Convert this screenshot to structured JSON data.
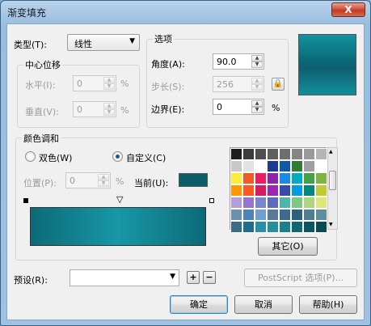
{
  "window": {
    "title": "渐变填充",
    "close_label": "X"
  },
  "type_row": {
    "label": "类型(T):",
    "selected": "线性"
  },
  "center_offset": {
    "title": "中心位移",
    "horizontal_label": "水平(I):",
    "horizontal_value": "0",
    "vertical_label": "垂直(V):",
    "vertical_value": "0",
    "unit": "%"
  },
  "options": {
    "title": "选项",
    "angle_label": "角度(A):",
    "angle_value": "90.0",
    "steps_label": "步长(S):",
    "steps_value": "256",
    "edge_label": "边界(E):",
    "edge_value": "0",
    "unit": "%"
  },
  "color_blend": {
    "title": "颜色调和",
    "two_color_label": "双色(W)",
    "custom_label": "自定义(C)",
    "selected_mode": "custom",
    "position_label": "位置(P):",
    "position_value": "0",
    "unit": "%",
    "current_label": "当前(U):",
    "current_color": "#0d5d6b",
    "gradient_start": "#0c6a78",
    "gradient_mid": "#1897a6",
    "other_button": "其它(O)"
  },
  "palette_colors": [
    "#1e1e1e",
    "#3b3b3b",
    "#4f4f4f",
    "#5e5e5e",
    "#6f6f6f",
    "#858585",
    "#9a9a9a",
    "#b5b5b5",
    "#c8c8c8",
    "#e2e2e2",
    "#ffffff",
    "#1f3a93",
    "#0f59a8",
    "#2e7d32",
    "#a0a0a0",
    "#ffffff",
    "#ffeb3b",
    "#f15a24",
    "#e91e63",
    "#8e24aa",
    "#1e88e5",
    "#00acc1",
    "#43a047",
    "#7cb342",
    "#ff9800",
    "#ff5722",
    "#d81b60",
    "#9c27b0",
    "#3949ab",
    "#039be5",
    "#00897b",
    "#c0ca33",
    "#b39ddb",
    "#9575cd",
    "#7986cb",
    "#5c6bc0",
    "#4db6ac",
    "#81c784",
    "#aed581",
    "#dce775",
    "#6d8fb0",
    "#4f83b8",
    "#6fa0d0",
    "#5a7a9a",
    "#3e6a8e",
    "#2d5f7f",
    "#4e7f8f",
    "#5b8fa0",
    "#3b6d8a",
    "#1c6e8a",
    "#2a8fa5",
    "#24909a",
    "#1b7f8c",
    "#0f6674",
    "#0b5561",
    "#0a4a55"
  ],
  "preset": {
    "label": "预设(R):",
    "value": "",
    "add_label": "+",
    "remove_label": "−"
  },
  "postscript_button": "PostScript 选项(P)...",
  "buttons": {
    "ok": "确定",
    "cancel": "取消",
    "help": "帮助(H)"
  }
}
